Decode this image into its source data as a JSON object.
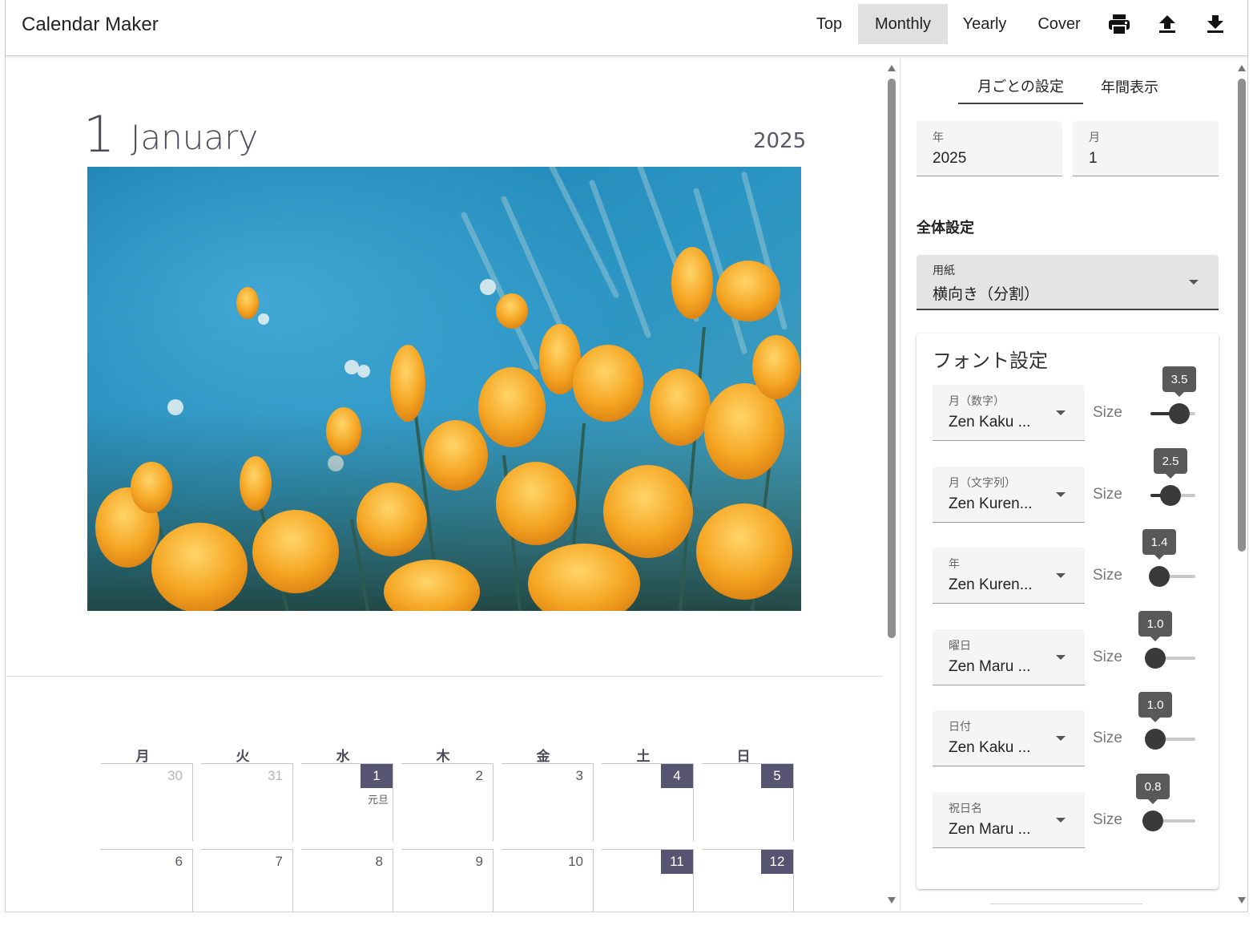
{
  "app": {
    "title": "Calendar Maker"
  },
  "nav": {
    "items": [
      {
        "label": "Top",
        "active": false
      },
      {
        "label": "Monthly",
        "active": true
      },
      {
        "label": "Yearly",
        "active": false
      },
      {
        "label": "Cover",
        "active": false
      }
    ],
    "tools": [
      {
        "icon": "print-icon"
      },
      {
        "icon": "upload-icon"
      },
      {
        "icon": "download-icon"
      }
    ]
  },
  "preview": {
    "month_number": "1",
    "month_name": "January",
    "year": "2025",
    "photo_subject": "flower-photo",
    "weekdays": [
      "月",
      "火",
      "水",
      "木",
      "金",
      "土",
      "日"
    ],
    "weeks": [
      [
        {
          "d": "30",
          "type": "other"
        },
        {
          "d": "31",
          "type": "other"
        },
        {
          "d": "1",
          "type": "holiday",
          "holiday": "元旦"
        },
        {
          "d": "2",
          "type": "normal"
        },
        {
          "d": "3",
          "type": "normal"
        },
        {
          "d": "4",
          "type": "weekend"
        },
        {
          "d": "5",
          "type": "weekend"
        }
      ],
      [
        {
          "d": "6",
          "type": "normal"
        },
        {
          "d": "7",
          "type": "normal"
        },
        {
          "d": "8",
          "type": "normal"
        },
        {
          "d": "9",
          "type": "normal"
        },
        {
          "d": "10",
          "type": "normal"
        },
        {
          "d": "11",
          "type": "weekend"
        },
        {
          "d": "12",
          "type": "weekend"
        }
      ]
    ]
  },
  "settings": {
    "tabs": [
      {
        "label": "月ごとの設定",
        "active": true
      },
      {
        "label": "年間表示",
        "active": false
      }
    ],
    "year_field": {
      "label": "年",
      "value": "2025"
    },
    "month_field": {
      "label": "月",
      "value": "1"
    },
    "section_title": "全体設定",
    "paper": {
      "label": "用紙",
      "value": "横向き（分割）"
    },
    "font_card": {
      "title": "フォント設定",
      "size_label": "Size",
      "rows": [
        {
          "label": "月（数字）",
          "font": "Zen Kaku ...",
          "size": "3.5",
          "fraction": 0.65
        },
        {
          "label": "月（文字列）",
          "font": "Zen Kuren...",
          "size": "2.5",
          "fraction": 0.45
        },
        {
          "label": "年",
          "font": "Zen Kuren...",
          "size": "1.4",
          "fraction": 0.2
        },
        {
          "label": "曜日",
          "font": "Zen Maru ...",
          "size": "1.0",
          "fraction": 0.1
        },
        {
          "label": "日付",
          "font": "Zen Kaku ...",
          "size": "1.0",
          "fraction": 0.1
        },
        {
          "label": "祝日名",
          "font": "Zen Maru ...",
          "size": "0.8",
          "fraction": 0.05
        }
      ]
    }
  },
  "colors": {
    "accent": "#565470",
    "active_nav": "#e0e0e0",
    "slider_thumb": "#3a3a3a"
  }
}
